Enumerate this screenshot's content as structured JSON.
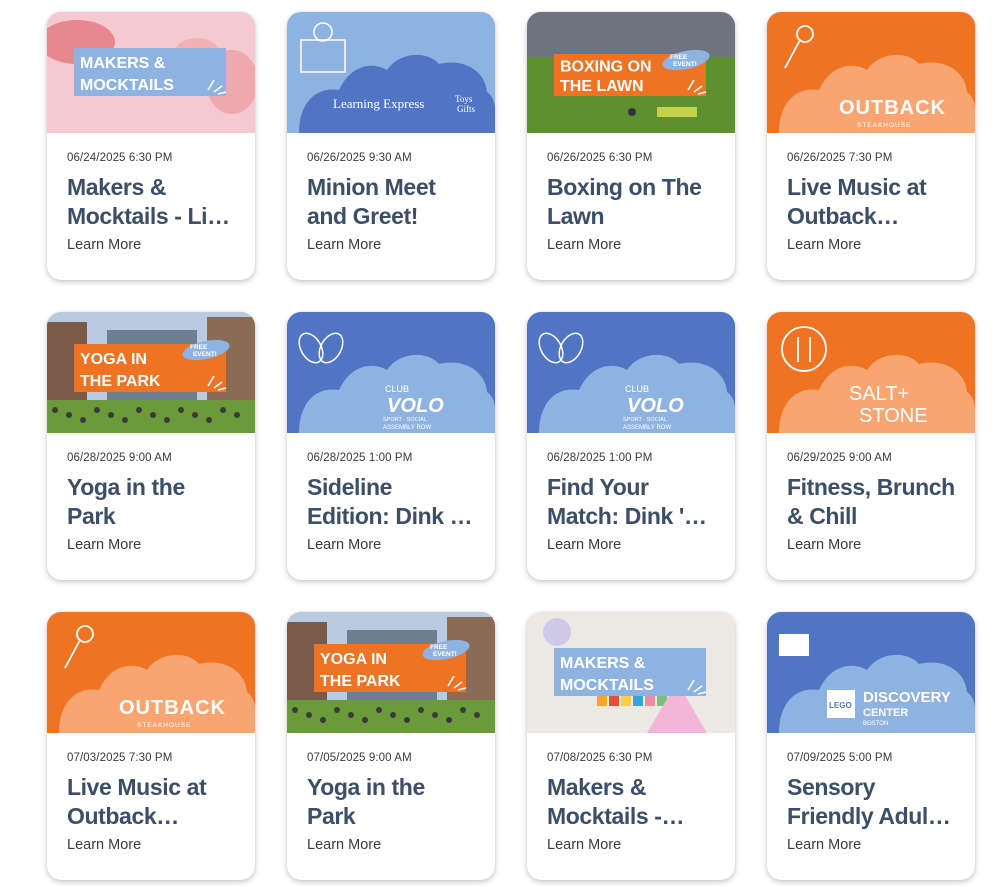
{
  "events": [
    {
      "date": "06/24/2025 6:30 PM",
      "title_lines": [
        "Makers &",
        "Mocktails - Li…"
      ],
      "link": "Learn More",
      "thumb": "makers-pink",
      "banner": [
        "MAKERS &",
        "MOCKTAILS"
      ]
    },
    {
      "date": "06/26/2025 9:30 AM",
      "title_lines": [
        "Minion Meet",
        "and Greet!"
      ],
      "link": "Learn More",
      "thumb": "learning-express",
      "logo": [
        "Learning Express",
        "Toys",
        "Gifts"
      ]
    },
    {
      "date": "06/26/2025 6:30 PM",
      "title_lines": [
        "Boxing on The",
        "Lawn"
      ],
      "link": "Learn More",
      "thumb": "boxing",
      "banner": [
        "BOXING ON",
        "THE LAWN"
      ],
      "badge": "FREE EVENT!"
    },
    {
      "date": "06/26/2025 7:30 PM",
      "title_lines": [
        "Live Music at",
        "Outback…"
      ],
      "link": "Learn More",
      "thumb": "outback",
      "logo": [
        "OUTBACK",
        "STEAKHOUSE"
      ]
    },
    {
      "date": "06/28/2025 9:00 AM",
      "title_lines": [
        "Yoga in the",
        "Park"
      ],
      "link": "Learn More",
      "thumb": "yoga",
      "banner": [
        "YOGA IN",
        "THE PARK"
      ],
      "badge": "FREE EVENT!"
    },
    {
      "date": "06/28/2025 1:00 PM",
      "title_lines": [
        "Sideline",
        "Edition: Dink …"
      ],
      "link": "Learn More",
      "thumb": "volo",
      "logo": [
        "CLUB",
        "VOLO",
        "SPORT · SOCIAL",
        "ASSEMBLY ROW"
      ]
    },
    {
      "date": "06/28/2025 1:00 PM",
      "title_lines": [
        "Find Your",
        "Match: Dink '…"
      ],
      "link": "Learn More",
      "thumb": "volo",
      "logo": [
        "CLUB",
        "VOLO",
        "SPORT · SOCIAL",
        "ASSEMBLY ROW"
      ]
    },
    {
      "date": "06/29/2025 9:00 AM",
      "title_lines": [
        "Fitness, Brunch",
        "& Chill"
      ],
      "link": "Learn More",
      "thumb": "salt-stone",
      "logo": [
        "SALT+",
        "STONE"
      ]
    },
    {
      "date": "07/03/2025 7:30 PM",
      "title_lines": [
        "Live Music at",
        "Outback…"
      ],
      "link": "Learn More",
      "thumb": "outback",
      "logo": [
        "OUTBACK",
        "STEAKHOUSE"
      ]
    },
    {
      "date": "07/05/2025 9:00 AM",
      "title_lines": [
        "Yoga in the",
        "Park"
      ],
      "link": "Learn More",
      "thumb": "yoga",
      "banner": [
        "YOGA IN",
        "THE PARK"
      ],
      "badge": "FREE EVENT!"
    },
    {
      "date": "07/08/2025 6:30 PM",
      "title_lines": [
        "Makers &",
        "Mocktails -…"
      ],
      "link": "Learn More",
      "thumb": "makers-paint",
      "banner": [
        "MAKERS &",
        "MOCKTAILS"
      ]
    },
    {
      "date": "07/09/2025 5:00 PM",
      "title_lines": [
        "Sensory",
        "Friendly Adul…"
      ],
      "link": "Learn More",
      "thumb": "lego",
      "logo": [
        "LEGO",
        "DISCOVERY",
        "CENTER",
        "BOSTON"
      ]
    }
  ],
  "colors": {
    "title": "#3c4f66",
    "orange": "#ee7423",
    "light_blue": "#8fb3e0",
    "blue": "#4f75c4",
    "peach": "#f8a571"
  }
}
